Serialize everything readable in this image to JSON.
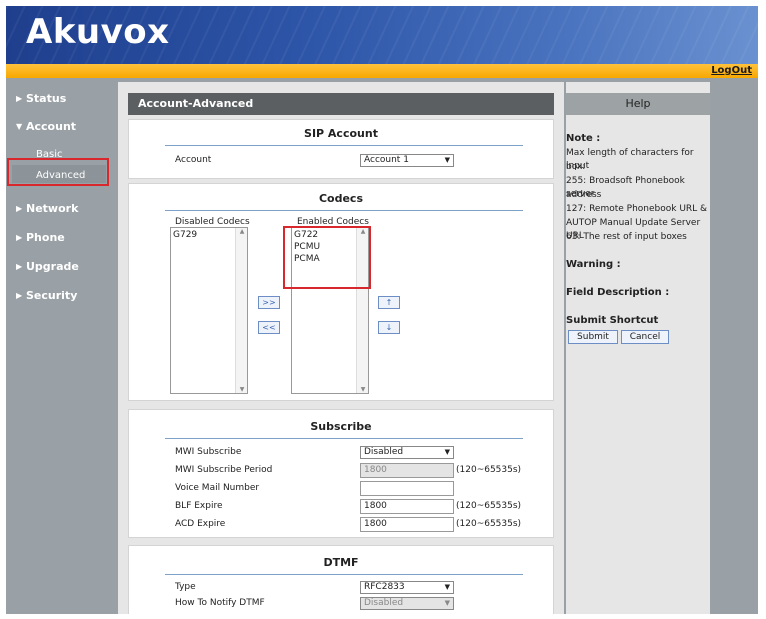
{
  "header": {
    "logo_text": "Akuvox",
    "logout_label": "LogOut"
  },
  "sidebar": {
    "status": "Status",
    "account": "Account",
    "account_basic": "Basic",
    "account_advanced": "Advanced",
    "network": "Network",
    "phone": "Phone",
    "upgrade": "Upgrade",
    "security": "Security"
  },
  "page": {
    "title": "Account-Advanced"
  },
  "sip_account": {
    "title": "SIP Account",
    "account_label": "Account",
    "account_value": "Account 1"
  },
  "codecs": {
    "title": "Codecs",
    "disabled_label": "Disabled Codecs",
    "enabled_label": "Enabled Codecs",
    "disabled": [
      "G729"
    ],
    "enabled": [
      "G722",
      "PCMU",
      "PCMA"
    ],
    "move_right": ">>",
    "move_left": "<<",
    "up": "↑",
    "down": "↓"
  },
  "subscribe": {
    "title": "Subscribe",
    "mwi_label": "MWI Subscribe",
    "mwi_value": "Disabled",
    "period_label": "MWI Subscribe Period",
    "period_value": "1800",
    "period_range": "(120~65535s)",
    "voicemail_label": "Voice Mail Number",
    "voicemail_value": "",
    "blf_label": "BLF Expire",
    "blf_value": "1800",
    "blf_range": "(120~65535s)",
    "acd_label": "ACD Expire",
    "acd_value": "1800",
    "acd_range": "(120~65535s)"
  },
  "dtmf": {
    "title": "DTMF",
    "type_label": "Type",
    "type_value": "RFC2833",
    "notify_label": "How To Notify DTMF",
    "notify_value": "Disabled"
  },
  "help": {
    "title": "Help",
    "note_label": "Note :",
    "note_lines": [
      "Max length of characters for input",
      "box:",
      "255: Broadsoft Phonebook server",
      "address",
      "127: Remote Phonebook URL &",
      "AUTOP Manual Update Server URL",
      "63: The rest of input boxes"
    ],
    "warning_label": "Warning :",
    "field_label": "Field Description :",
    "shortcut_label": "Submit Shortcut",
    "submit": "Submit",
    "cancel": "Cancel"
  },
  "colors": {
    "banner": "#2d55a8",
    "accent_orange": "#f7a800",
    "sidebar": "#9aa1a6",
    "highlight_red": "#d9272e",
    "section_head": "#5b5f62"
  }
}
